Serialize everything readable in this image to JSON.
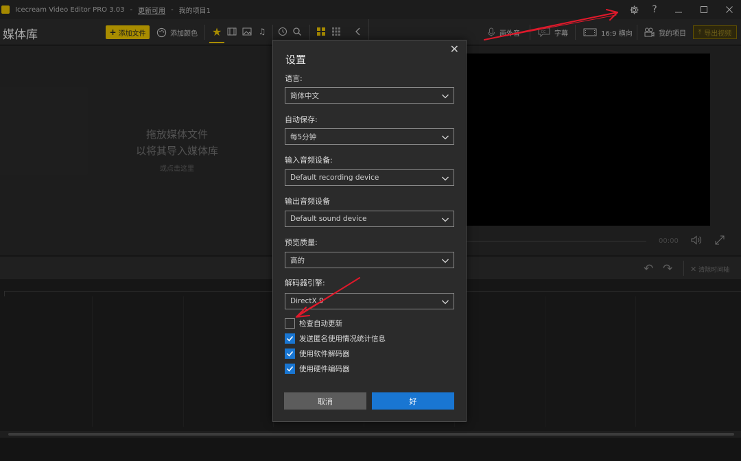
{
  "window": {
    "app_title": "Icecream Video Editor PRO 3.03",
    "sep1": "-",
    "update_link": "更新可用",
    "sep2": "-",
    "project_name": "我的项目1",
    "help_label": "?"
  },
  "toolbar": {
    "library_title": "媒体库",
    "add_file": "添加文件",
    "add_color": "添加颜色",
    "voiceover": "画外音",
    "subtitles": "字幕",
    "aspect": "16:9 横向",
    "my_projects": "我的项目",
    "export": "导出视频"
  },
  "media": {
    "drop_line1": "拖放媒体文件",
    "drop_line2": "以将其导入媒体库",
    "drop_line3": "或点击这里"
  },
  "preview": {
    "timecode": "00:00"
  },
  "timeline": {
    "clear": "清除时间轴"
  },
  "dialog": {
    "title": "设置",
    "fields": [
      {
        "label": "语言:",
        "value": "简体中文"
      },
      {
        "label": "自动保存:",
        "value": "每5分钟"
      },
      {
        "label": "输入音频设备:",
        "value": "Default recording device"
      },
      {
        "label": "输出音频设备",
        "value": "Default sound device"
      },
      {
        "label": "预览质量:",
        "value": "高的"
      },
      {
        "label": "解码器引擎:",
        "value": "DirectX 9"
      }
    ],
    "checkboxes": [
      {
        "label": "检查自动更新",
        "checked": false
      },
      {
        "label": "发送匿名使用情况统计信息",
        "checked": true
      },
      {
        "label": "使用软件解码器",
        "checked": true
      },
      {
        "label": "使用硬件编码器",
        "checked": true
      }
    ],
    "cancel": "取消",
    "ok": "好"
  },
  "colors": {
    "accent": "#d8b400",
    "primary_button": "#1976d2",
    "annotation_arrow": "#e0192b"
  }
}
